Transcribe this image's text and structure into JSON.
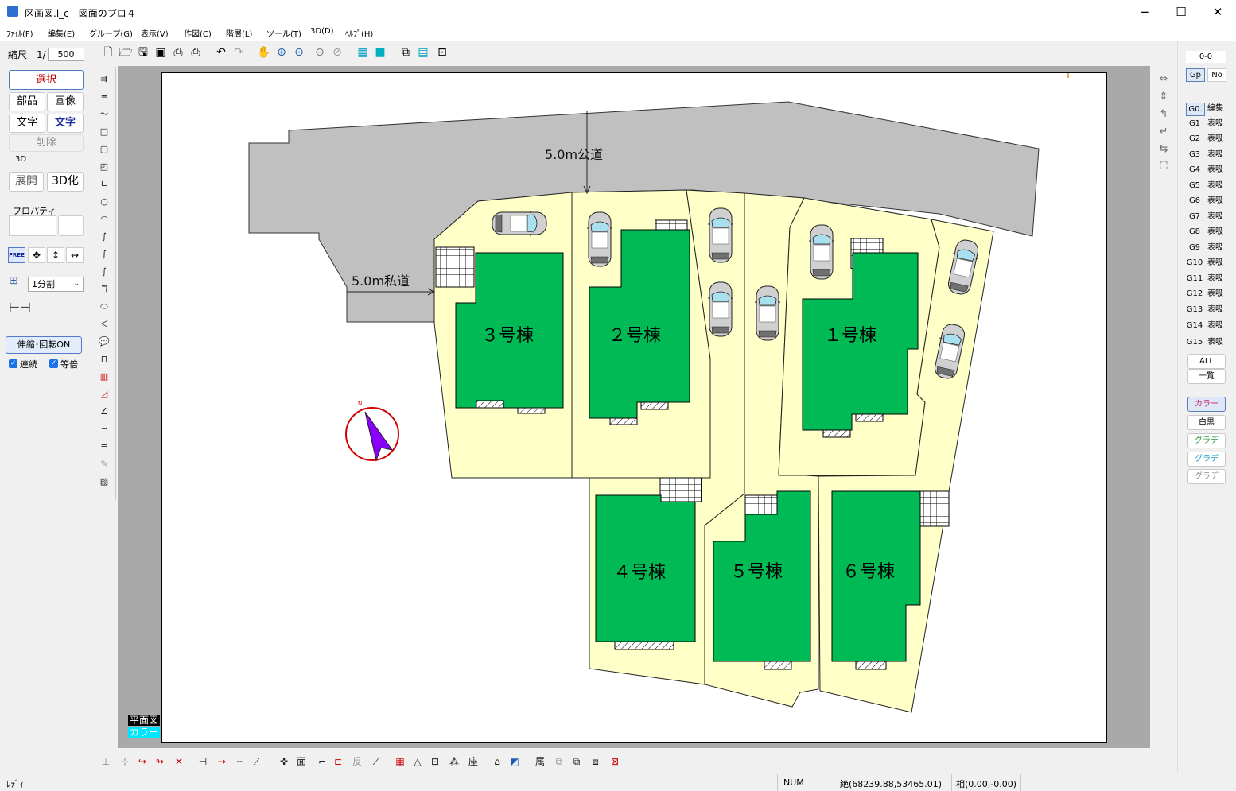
{
  "window": {
    "title": "区画図.l_c - 図面のプロ４",
    "minimize": "−",
    "maximize": "☐",
    "close": "✕"
  },
  "menu": [
    "ﾌｧｲﾙ(F)",
    "編集(E)",
    "グループ(G)",
    "表示(V)",
    "作図(C)",
    "階層(L)",
    "ツール(T)",
    "3D(D)",
    "ﾍﾙﾌﾟ(H)"
  ],
  "scale": {
    "label": "縮尺　1/",
    "value": "500"
  },
  "left_panel": {
    "select": "選択",
    "parts": "部品",
    "image": "画像",
    "text": "文字",
    "text2": "文字",
    "delete": "削除",
    "section_3d": "3D",
    "expand": "展開",
    "to3d": "3D化",
    "property": "プロパティ",
    "free": "FREE",
    "split_value": "1分割",
    "stretch": "伸縮･回転ON",
    "continuous": "連続",
    "equal": "等倍"
  },
  "drawing": {
    "public_road": "5.0m公道",
    "private_road": "5.0m私道",
    "buildings": [
      "３号棟",
      "２号棟",
      "１号棟",
      "４号棟",
      "５号棟",
      "６号棟"
    ],
    "north": "N",
    "layer_label": "平面図",
    "layer_color": "カラー",
    "colors": {
      "road": "#c0c0c0",
      "lot": "#ffffc8",
      "building": "#00bb55",
      "north": "#8a00ff",
      "compass": "#d00000"
    }
  },
  "right_panel": {
    "layer": "0-0",
    "gp": "Gp",
    "no": "No",
    "groups": [
      {
        "id": "G0.",
        "state": "編集"
      },
      {
        "id": "G1",
        "state": "表吸"
      },
      {
        "id": "G2",
        "state": "表吸"
      },
      {
        "id": "G3",
        "state": "表吸"
      },
      {
        "id": "G4",
        "state": "表吸"
      },
      {
        "id": "G5",
        "state": "表吸"
      },
      {
        "id": "G6",
        "state": "表吸"
      },
      {
        "id": "G7",
        "state": "表吸"
      },
      {
        "id": "G8",
        "state": "表吸"
      },
      {
        "id": "G9",
        "state": "表吸"
      },
      {
        "id": "G10",
        "state": "表吸"
      },
      {
        "id": "G11",
        "state": "表吸"
      },
      {
        "id": "G12",
        "state": "表吸"
      },
      {
        "id": "G13",
        "state": "表吸"
      },
      {
        "id": "G14",
        "state": "表吸"
      },
      {
        "id": "G15",
        "state": "表吸"
      }
    ],
    "all": "ALL",
    "list": "一覧",
    "color": "カラー",
    "bw": "白黒",
    "grad1": "グラデ",
    "grad2": "グラデ",
    "grad3": "グラデ"
  },
  "status": {
    "ready": "ﾚﾃﾞｨ",
    "num": "NUM",
    "abs": "絶(68239.88,53465.01)",
    "rel": "相(0.00,-0.00)"
  }
}
